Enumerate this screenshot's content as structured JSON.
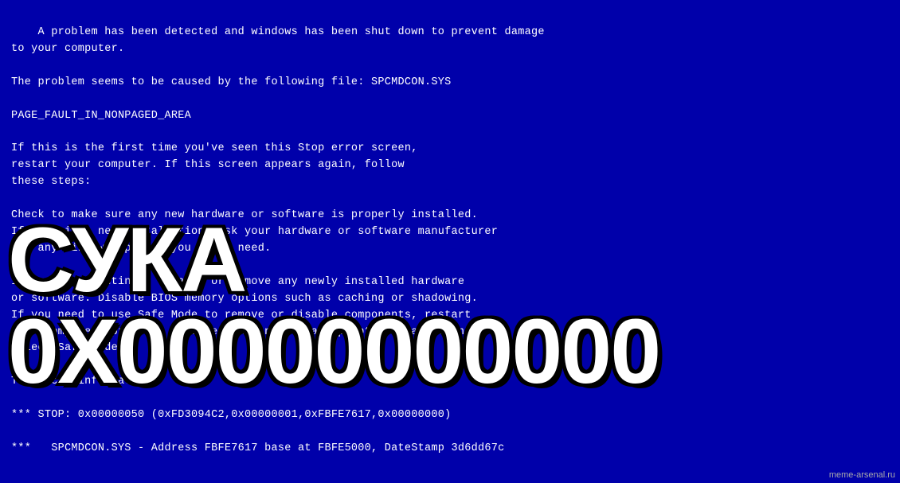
{
  "bsod": {
    "line1": "A problem has been detected and windows has been shut down to prevent damage",
    "line2": "to your computer.",
    "line3": "",
    "line4": "The problem seems to be caused by the following file: SPCMDCON.SYS",
    "line5": "",
    "line6": "PAGE_FAULT_IN_NONPAGED_AREA",
    "line7": "",
    "line8": "If this is the first time you've seen this Stop error screen,",
    "line9": "restart your computer. If this screen appears again, follow",
    "line10": "these steps:",
    "line11": "",
    "line12": "Check to make sure any new hardware or software is properly installed.",
    "line13": "If this is a new installation, ask your hardware or software manufacturer",
    "line14": "for any windows updates you might need.",
    "line15": "",
    "line16": "If problems continue, disable or remove any newly installed hardware",
    "line17": "or software. Disable BIOS memory options such as caching or shadowing.",
    "line18": "If you need to use Safe Mode to remove or disable components, restart",
    "line19": "your computer, press F8 to select Advanced Startup Options, and then",
    "line20": "select Safe Mode.",
    "line21": "",
    "line22": "Technical information:",
    "line23": "",
    "line24": "*** STOP: 0x00000050 (0xFD3094C2,0x00000001,0xFBFE7617,0x00000000)",
    "line25": "",
    "line26": "***   SPCMDCON.SYS - Address FBFE7617 base at FBFE5000, DateStamp 3d6dd67c"
  },
  "meme_text": "СУКА 0X00000000000",
  "watermark": "meme-arsenal.ru"
}
